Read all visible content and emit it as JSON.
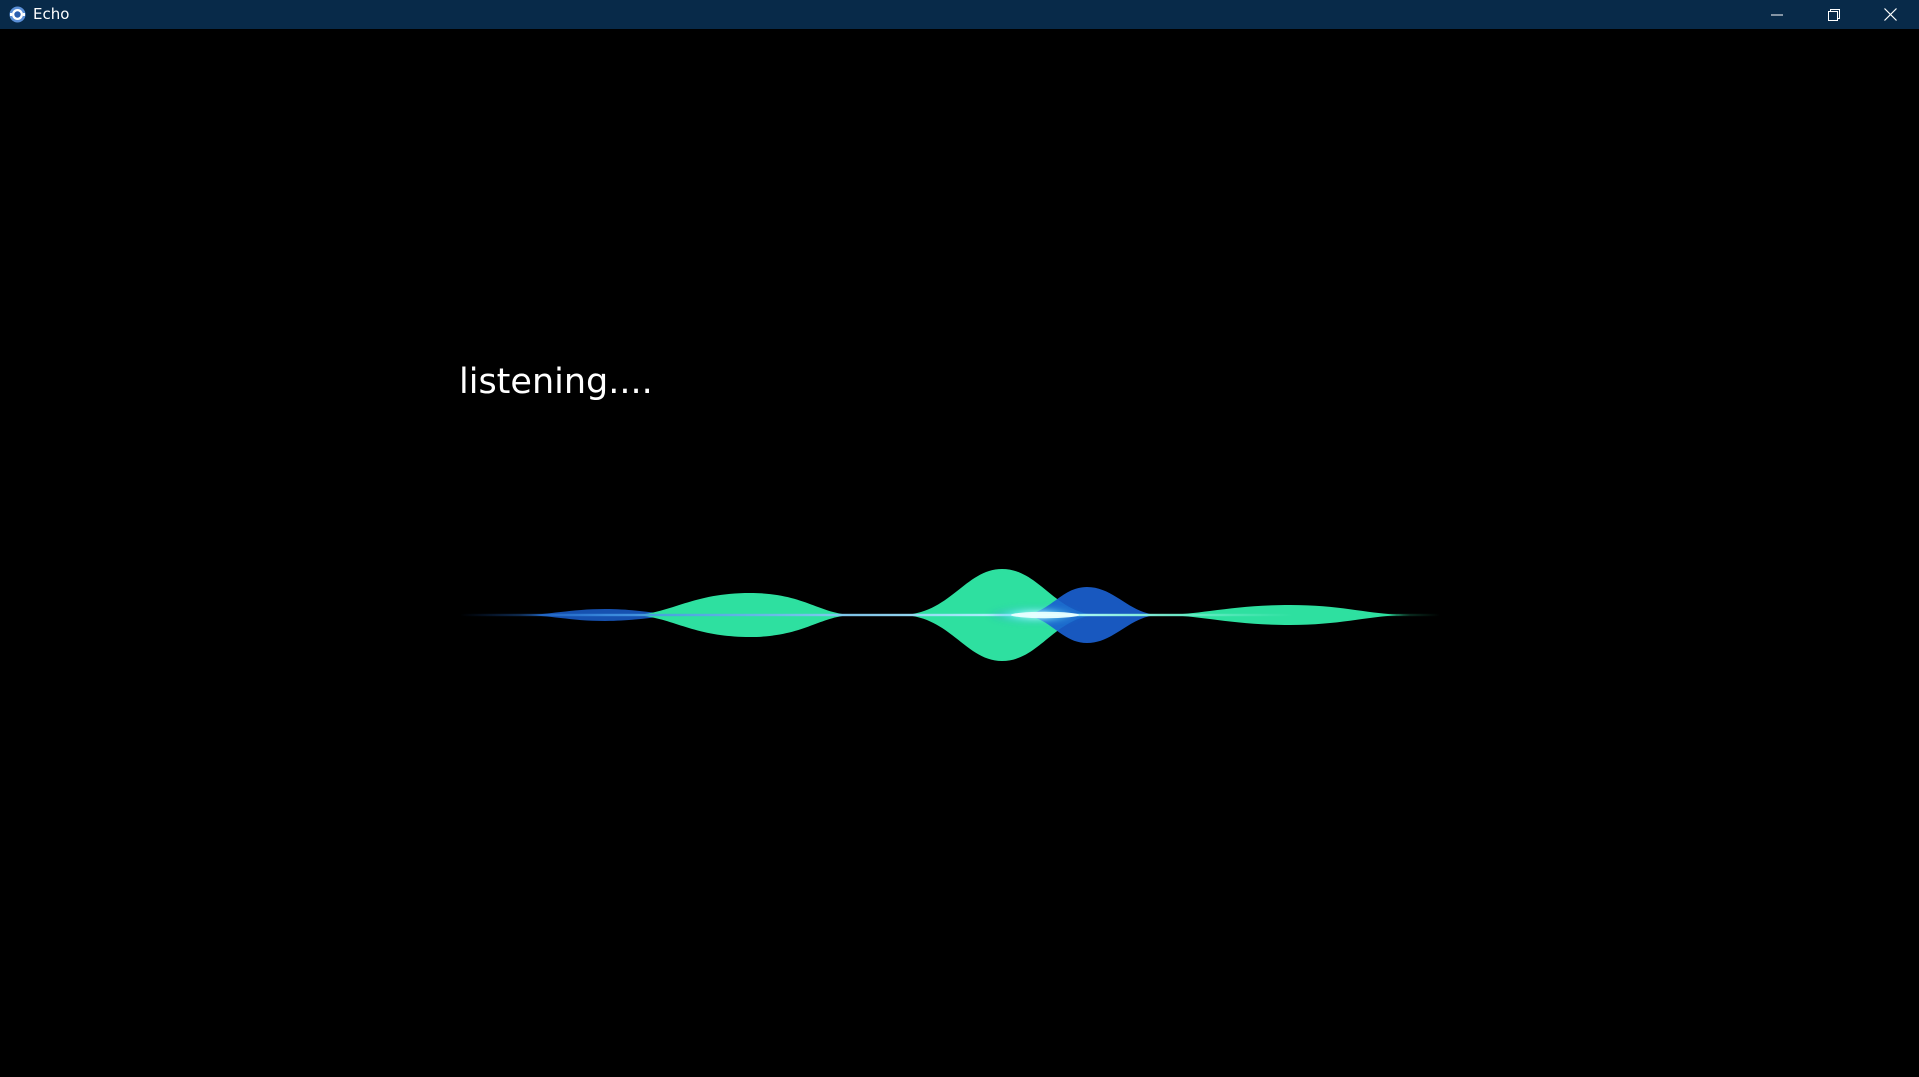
{
  "window": {
    "title": "Echo",
    "titlebar_color": "#082a49",
    "icon": "echo-app-icon",
    "controls": {
      "minimize_icon": "minimize-icon",
      "maximize_icon": "restore-icon",
      "close_icon": "close-icon"
    }
  },
  "main": {
    "status_text": "listening....",
    "background_color": "#000000",
    "waveform": {
      "state": "listening",
      "colors": {
        "primary": "#2ee0a0",
        "secondary": "#1a5fcf",
        "highlight": "#8ef8ff"
      }
    }
  }
}
